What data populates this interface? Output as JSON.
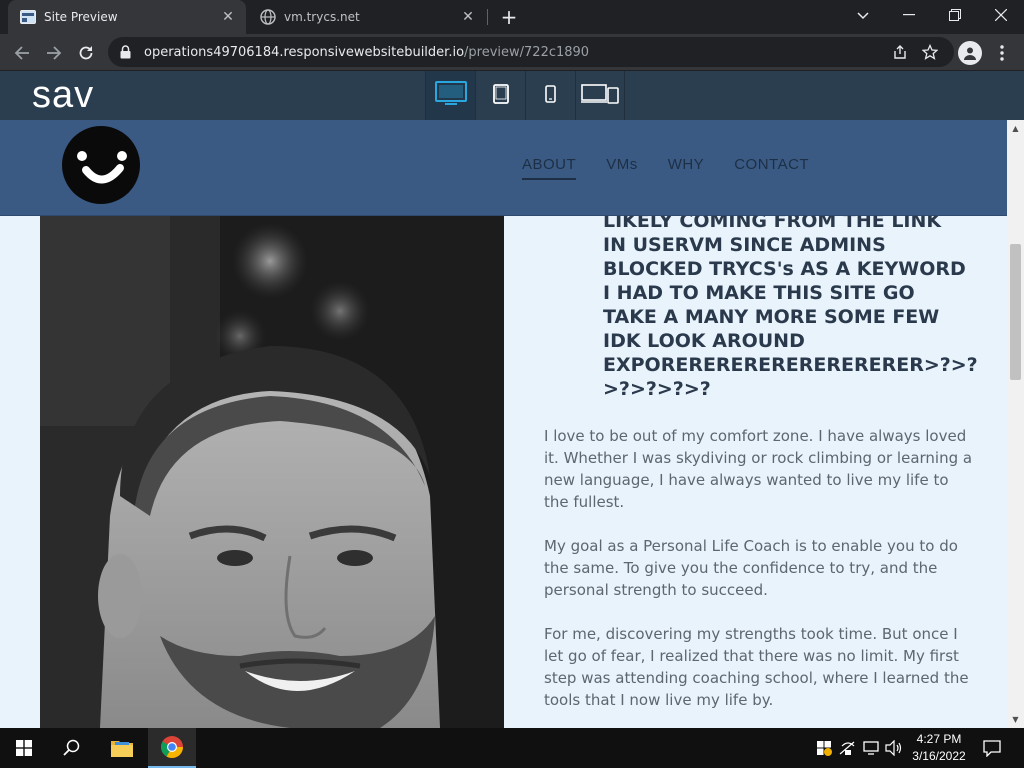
{
  "browser": {
    "tabs": [
      {
        "title": "Site Preview",
        "active": true
      },
      {
        "title": "vm.trycs.net",
        "active": false
      }
    ],
    "address": {
      "host": "operations49706184.responsivewebsitebuilder.io",
      "path": "/preview/722c1890"
    }
  },
  "builder": {
    "logo": "sav",
    "devices": [
      "desktop-icon",
      "tablet-icon",
      "mobile-icon",
      "all-devices-icon"
    ],
    "selected_device": "desktop-icon",
    "accent": "#29a8e0"
  },
  "site": {
    "nav": [
      {
        "label": "ABOUT",
        "active": true
      },
      {
        "label": "VMs",
        "active": false
      },
      {
        "label": "WHY",
        "active": false
      },
      {
        "label": "CONTACT",
        "active": false
      }
    ],
    "headline": "LIKELY COMING FROM THE LINK\nIN USERVM SINCE ADMINS\nBLOCKED TRYCS's AS A KEYWORD\nI HAD TO MAKE THIS SITE GO\nTAKE A MANY MORE SOME FEW\nIDK LOOK AROUND\nEXPORERERERERERERERERER>?>?\n>?>?>?>?",
    "paragraphs": [
      "I love to be out of my comfort zone. I have always loved it. Whether I was skydiving or rock climbing or learning a new language, I have always wanted to live my life to the fullest.",
      "My goal as a Personal Life Coach is to enable you to do the same. To give you the confidence to try, and the personal strength to succeed.",
      "For me, discovering my strengths took time. But once I let go of fear, I realized that there was no limit. My first step was attending coaching school, where I learned the tools that I now live my life by."
    ],
    "colors": {
      "header": "#3a5a84",
      "background": "#e9f3fb",
      "heading": "#2a3a4c",
      "body_text": "#5e6670"
    }
  },
  "taskbar": {
    "time": "4:27 PM",
    "date": "3/16/2022"
  }
}
